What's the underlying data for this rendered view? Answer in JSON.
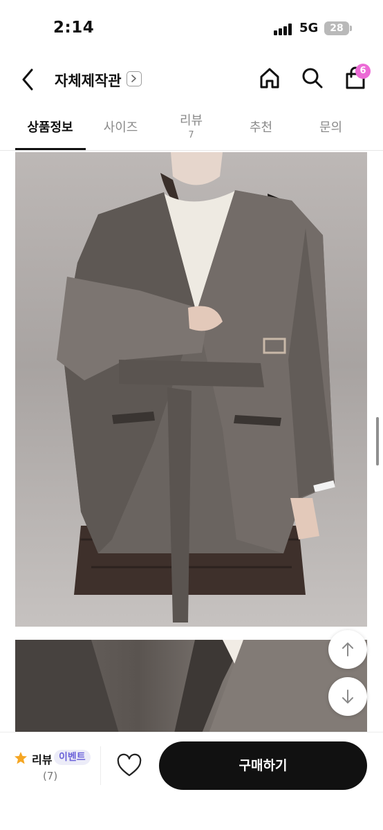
{
  "status_bar": {
    "time": "2:14",
    "network": "5G",
    "battery": "28"
  },
  "header": {
    "shop_name": "자체제작관",
    "cart_count": "6",
    "icons": [
      "back-icon",
      "chevron-right-icon",
      "home-icon",
      "search-icon",
      "shopping-bag-icon"
    ]
  },
  "tabs": [
    {
      "label": "상품정보",
      "active": true
    },
    {
      "label": "사이즈",
      "active": false
    },
    {
      "label": "리뷰",
      "count": "7",
      "active": false
    },
    {
      "label": "추천",
      "active": false
    },
    {
      "label": "문의",
      "active": false
    }
  ],
  "photos": [
    {
      "description": "product-photo-coat"
    },
    {
      "description": "product-photo-coat-detail"
    }
  ],
  "floating_buttons": [
    "arrow-up-icon",
    "arrow-down-icon"
  ],
  "bottom_bar": {
    "review_label": "리뷰",
    "event_label": "이벤트",
    "review_count": "(7)",
    "buy_label": "구매하기"
  },
  "colors": {
    "accent_badge": "#ec6ad6",
    "event_text": "#6b62d9",
    "buy_button": "#111111",
    "star": "#f5a623"
  }
}
